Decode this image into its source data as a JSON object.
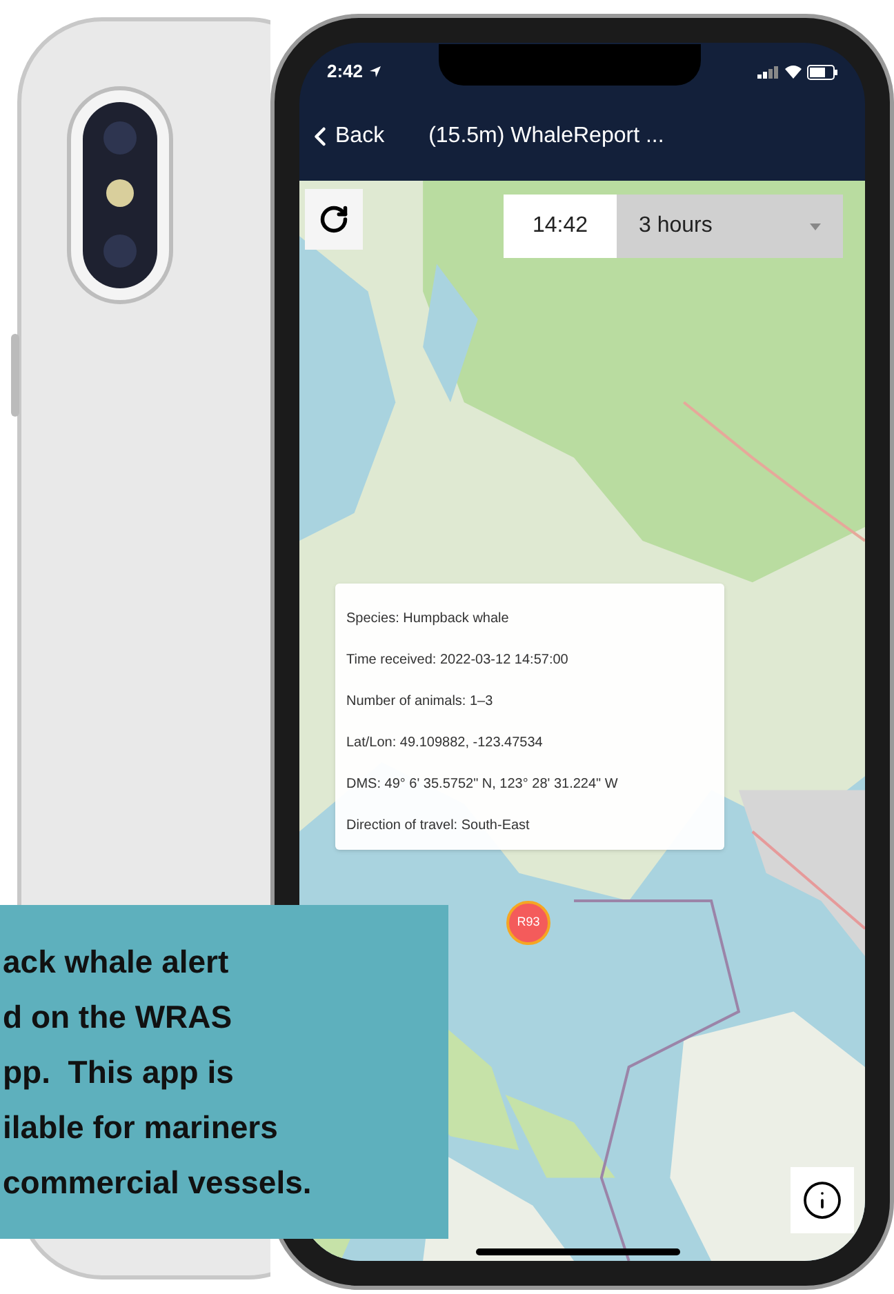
{
  "status_bar": {
    "time": "2:42"
  },
  "nav_bar": {
    "back": "Back",
    "title": "(15.5m) WhaleReport ..."
  },
  "map_controls": {
    "time": "14:42",
    "range": "3 hours"
  },
  "popup": {
    "lines": [
      "Species: Humpback whale",
      "Time received: 2022-03-12 14:57:00",
      "Number of animals: 1–3",
      "Lat/Lon: 49.109882, -123.47534",
      "DMS: 49° 6' 35.5752\" N, 123° 28' 31.224\" W",
      "Direction of travel: South-East"
    ]
  },
  "marker": {
    "label": "R93"
  },
  "caption": {
    "lines": [
      "ack whale alert",
      "d on the WRAS",
      "pp.  This app is",
      "ilable for mariners",
      "commercial vessels."
    ]
  }
}
